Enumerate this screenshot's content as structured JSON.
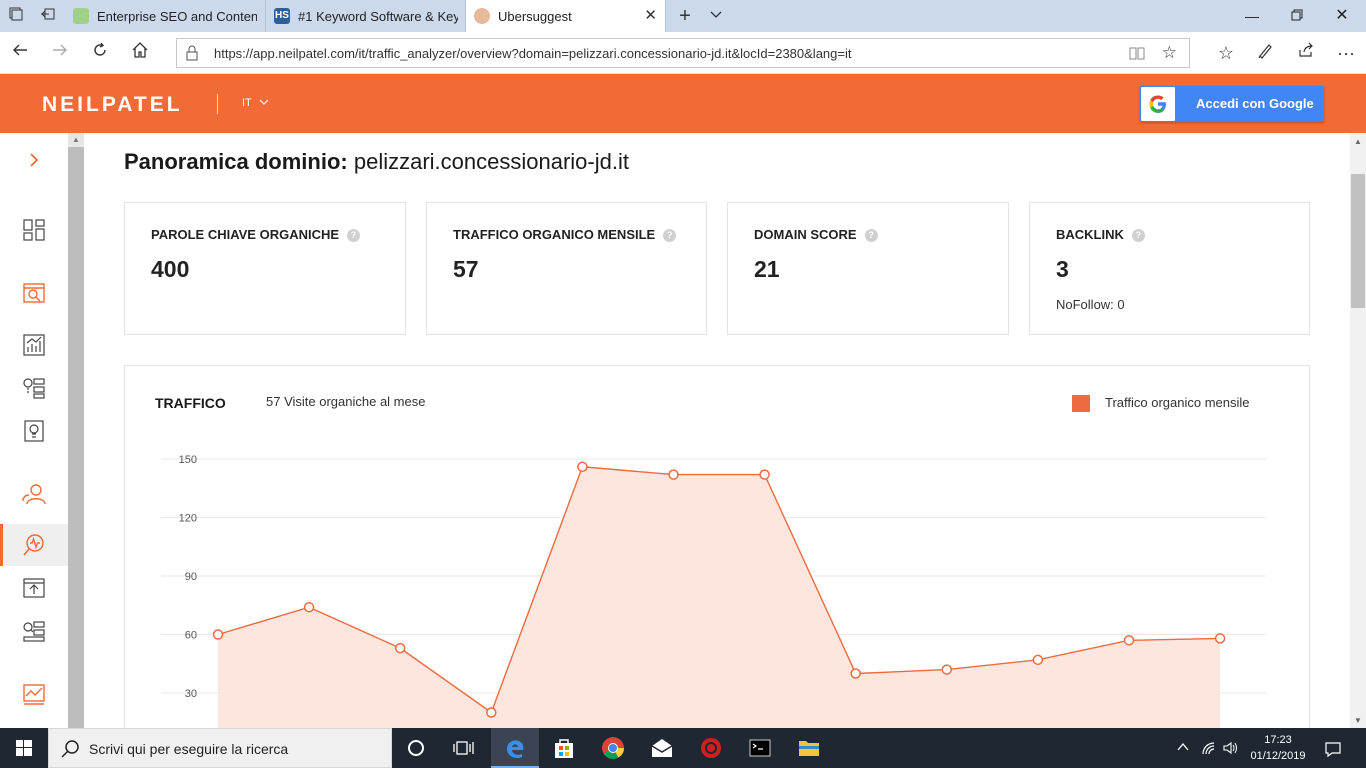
{
  "browser": {
    "tabs": [
      {
        "title": "Enterprise SEO and Content",
        "active": false
      },
      {
        "title": "#1 Keyword Software & Key",
        "active": false
      },
      {
        "title": "Ubersuggest",
        "active": true
      }
    ],
    "url": "https://app.neilpatel.com/it/traffic_analyzer/overview?domain=pelizzari.concessionario-jd.it&locId=2380&lang=it"
  },
  "header": {
    "logo": "NEILPATEL",
    "language": "IT",
    "google_button": "Accedi con Google"
  },
  "sidebar": {
    "items": [
      {
        "icon": "chevron-right-icon",
        "active": false
      },
      {
        "icon": "dashboard-icon",
        "active": false
      },
      {
        "icon": "site-audit-icon",
        "active": false
      },
      {
        "icon": "keyword-chart-icon",
        "active": false
      },
      {
        "icon": "keyword-ideas-icon",
        "active": false
      },
      {
        "icon": "content-ideas-icon",
        "active": false
      },
      {
        "icon": "users-icon",
        "active": false
      },
      {
        "icon": "traffic-analyzer-icon",
        "active": true
      },
      {
        "icon": "top-pages-icon",
        "active": false
      },
      {
        "icon": "list-icon",
        "active": false
      },
      {
        "icon": "backlinks-icon",
        "active": false
      }
    ]
  },
  "main": {
    "title_label": "Panoramica dominio:",
    "domain": "pelizzari.concessionario-jd.it",
    "cards": [
      {
        "label": "PAROLE CHIAVE ORGANICHE",
        "value": "400",
        "sub": ""
      },
      {
        "label": "TRAFFICO ORGANICO MENSILE",
        "value": "57",
        "sub": ""
      },
      {
        "label": "DOMAIN SCORE",
        "value": "21",
        "sub": ""
      },
      {
        "label": "BACKLINK",
        "value": "3",
        "sub": "NoFollow: 0"
      }
    ],
    "traffic": {
      "title": "TRAFFICO",
      "subtitle": "57 Visite organiche al mese",
      "legend": "Traffico organico mensile"
    }
  },
  "chart_data": {
    "type": "area",
    "series": [
      {
        "name": "Traffico organico mensile",
        "values": [
          60,
          74,
          53,
          20,
          146,
          142,
          142,
          40,
          42,
          47,
          57,
          58
        ]
      }
    ],
    "y_ticks": [
      150,
      120,
      90,
      60,
      30
    ],
    "ylim": [
      0,
      150
    ],
    "grid": true,
    "legend_position": "top-right",
    "colors": {
      "line": "#ee6a40",
      "fill": "#fde6de"
    }
  },
  "taskbar": {
    "search_placeholder": "Scrivi qui per eseguire la ricerca",
    "time": "17:23",
    "date": "01/12/2019"
  },
  "colors": {
    "brand": "#f26a35",
    "google_blue": "#4285f4",
    "taskbar": "#1f2733"
  }
}
